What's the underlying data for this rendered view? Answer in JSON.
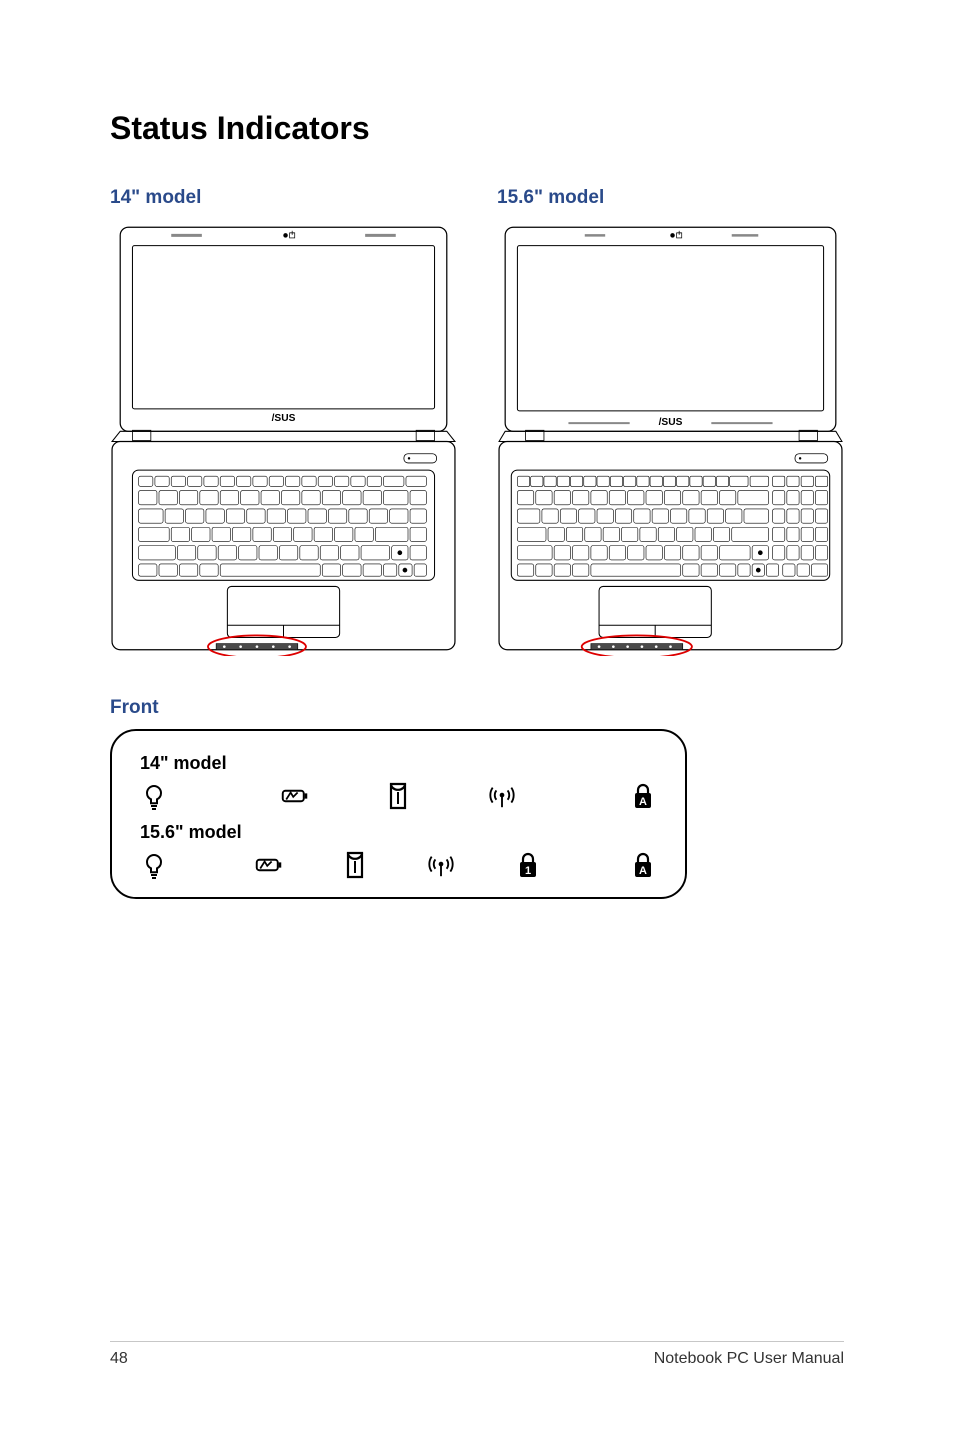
{
  "page": {
    "number": "48",
    "footer_text": "Notebook PC User Manual"
  },
  "headings": {
    "main": "Status Indicators",
    "model14": "14\" model",
    "model156": "15.6\" model",
    "front": "Front"
  },
  "front_box": {
    "label14": "14\" model",
    "label156": "15.6\" model"
  },
  "icons": {
    "power": "power-indicator",
    "battery": "battery-indicator",
    "drive": "drive-activity",
    "wireless": "wireless-indicator",
    "numlock": "num-lock",
    "capslock": "caps-lock"
  }
}
